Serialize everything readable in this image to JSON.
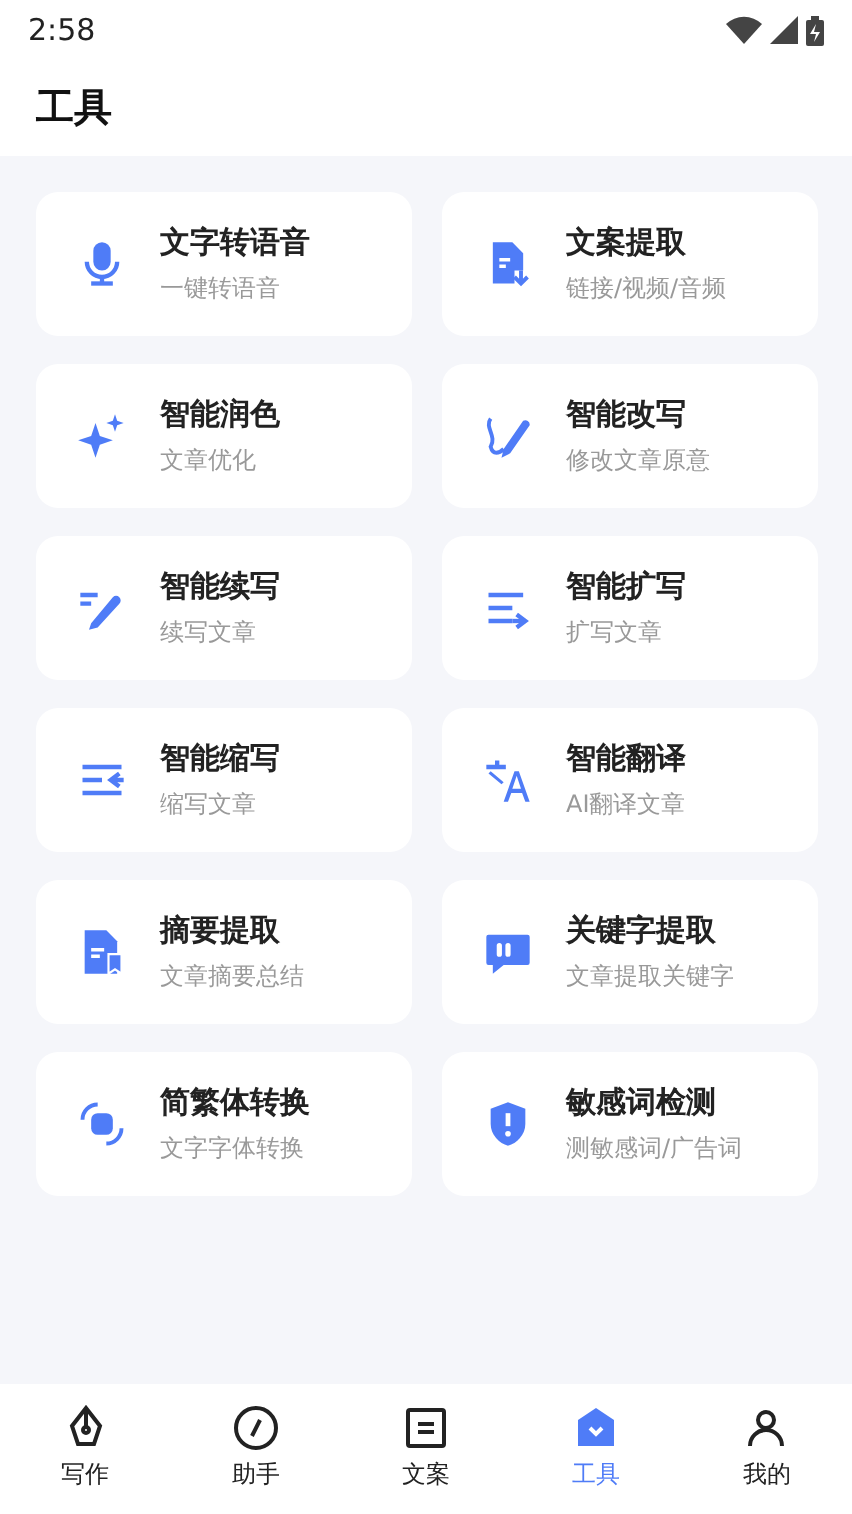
{
  "status_bar": {
    "time": "2:58"
  },
  "header": {
    "title": "工具"
  },
  "tools": [
    {
      "title": "文字转语音",
      "subtitle": "一键转语音"
    },
    {
      "title": "文案提取",
      "subtitle": "链接/视频/音频"
    },
    {
      "title": "智能润色",
      "subtitle": "文章优化"
    },
    {
      "title": "智能改写",
      "subtitle": "修改文章原意"
    },
    {
      "title": "智能续写",
      "subtitle": "续写文章"
    },
    {
      "title": "智能扩写",
      "subtitle": "扩写文章"
    },
    {
      "title": "智能缩写",
      "subtitle": "缩写文章"
    },
    {
      "title": "智能翻译",
      "subtitle": "AI翻译文章"
    },
    {
      "title": "摘要提取",
      "subtitle": "文章摘要总结"
    },
    {
      "title": "关键字提取",
      "subtitle": "文章提取关键字"
    },
    {
      "title": "简繁体转换",
      "subtitle": "文字字体转换"
    },
    {
      "title": "敏感词检测",
      "subtitle": "测敏感词/广告词"
    }
  ],
  "nav": [
    {
      "label": "写作",
      "selected": false
    },
    {
      "label": "助手",
      "selected": false
    },
    {
      "label": "文案",
      "selected": false
    },
    {
      "label": "工具",
      "selected": true
    },
    {
      "label": "我的",
      "selected": false
    }
  ]
}
